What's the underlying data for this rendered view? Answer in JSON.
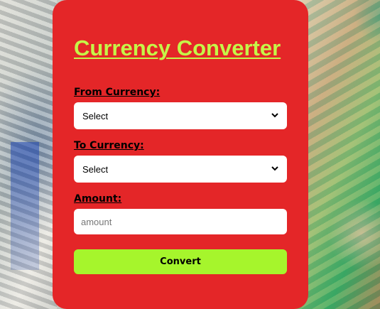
{
  "title": "Currency Converter",
  "from": {
    "label": "From Currency:",
    "selected": "Select"
  },
  "to": {
    "label": "To Currency:",
    "selected": "Select"
  },
  "amount": {
    "label": "Amount:",
    "placeholder": "amount",
    "value": ""
  },
  "convert_label": "Convert",
  "colors": {
    "card": "#e42628",
    "title": "#c5f548",
    "button": "#a6f52c"
  },
  "icons": [
    "chevron-down-icon"
  ]
}
